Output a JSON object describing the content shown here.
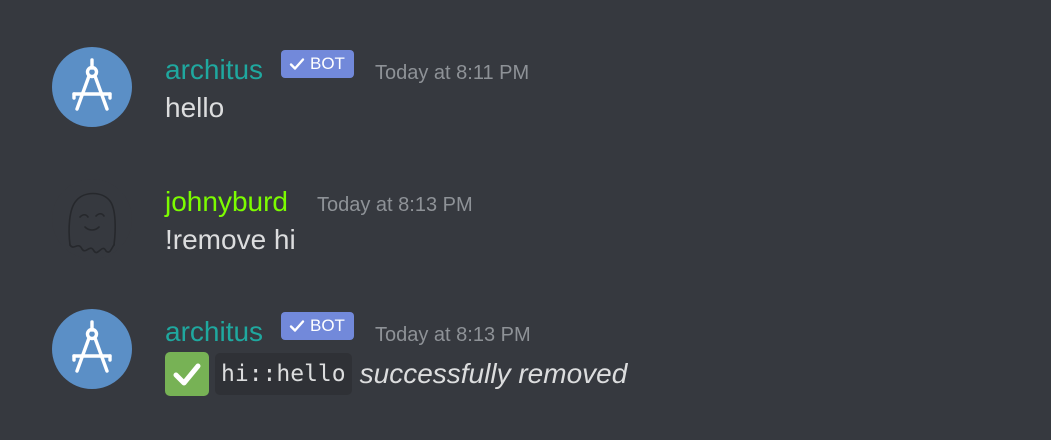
{
  "messages": [
    {
      "author": "architus",
      "is_bot": true,
      "bot_tag": "BOT",
      "timestamp": "Today at 8:11 PM",
      "text": "hello",
      "avatar": "compass-icon"
    },
    {
      "author": "johnyburd",
      "is_bot": false,
      "timestamp": "Today at 8:13 PM",
      "text": "!remove hi",
      "avatar": "ghost-sketch-icon"
    },
    {
      "author": "architus",
      "is_bot": true,
      "bot_tag": "BOT",
      "timestamp": "Today at 8:13 PM",
      "emoji": "white-check-mark-icon",
      "code": "hi::hello",
      "italic": "successfully removed",
      "avatar": "compass-icon"
    }
  ],
  "colors": {
    "background": "#36393f",
    "bot_name": "#1fa89f",
    "user_name": "#7cfc00",
    "bot_tag": "#7289da",
    "timestamp": "#8e9297",
    "text": "#dcddde",
    "check_emoji": "#77b255"
  }
}
